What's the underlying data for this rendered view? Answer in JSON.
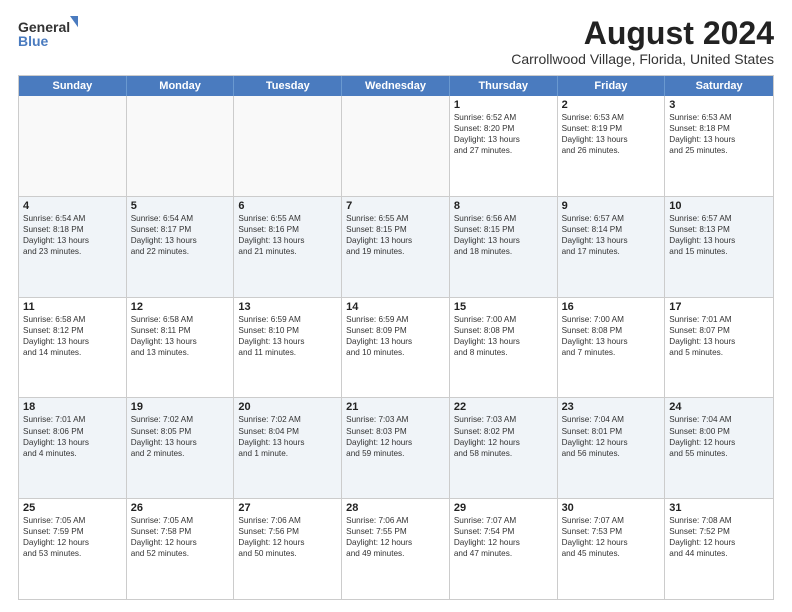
{
  "logo": {
    "line1": "General",
    "line2": "Blue"
  },
  "title": "August 2024",
  "subtitle": "Carrollwood Village, Florida, United States",
  "weekdays": [
    "Sunday",
    "Monday",
    "Tuesday",
    "Wednesday",
    "Thursday",
    "Friday",
    "Saturday"
  ],
  "weeks": [
    [
      {
        "day": "",
        "lines": [],
        "empty": true
      },
      {
        "day": "",
        "lines": [],
        "empty": true
      },
      {
        "day": "",
        "lines": [],
        "empty": true
      },
      {
        "day": "",
        "lines": [],
        "empty": true
      },
      {
        "day": "1",
        "lines": [
          "Sunrise: 6:52 AM",
          "Sunset: 8:20 PM",
          "Daylight: 13 hours",
          "and 27 minutes."
        ],
        "empty": false
      },
      {
        "day": "2",
        "lines": [
          "Sunrise: 6:53 AM",
          "Sunset: 8:19 PM",
          "Daylight: 13 hours",
          "and 26 minutes."
        ],
        "empty": false
      },
      {
        "day": "3",
        "lines": [
          "Sunrise: 6:53 AM",
          "Sunset: 8:18 PM",
          "Daylight: 13 hours",
          "and 25 minutes."
        ],
        "empty": false
      }
    ],
    [
      {
        "day": "4",
        "lines": [
          "Sunrise: 6:54 AM",
          "Sunset: 8:18 PM",
          "Daylight: 13 hours",
          "and 23 minutes."
        ],
        "empty": false
      },
      {
        "day": "5",
        "lines": [
          "Sunrise: 6:54 AM",
          "Sunset: 8:17 PM",
          "Daylight: 13 hours",
          "and 22 minutes."
        ],
        "empty": false
      },
      {
        "day": "6",
        "lines": [
          "Sunrise: 6:55 AM",
          "Sunset: 8:16 PM",
          "Daylight: 13 hours",
          "and 21 minutes."
        ],
        "empty": false
      },
      {
        "day": "7",
        "lines": [
          "Sunrise: 6:55 AM",
          "Sunset: 8:15 PM",
          "Daylight: 13 hours",
          "and 19 minutes."
        ],
        "empty": false
      },
      {
        "day": "8",
        "lines": [
          "Sunrise: 6:56 AM",
          "Sunset: 8:15 PM",
          "Daylight: 13 hours",
          "and 18 minutes."
        ],
        "empty": false
      },
      {
        "day": "9",
        "lines": [
          "Sunrise: 6:57 AM",
          "Sunset: 8:14 PM",
          "Daylight: 13 hours",
          "and 17 minutes."
        ],
        "empty": false
      },
      {
        "day": "10",
        "lines": [
          "Sunrise: 6:57 AM",
          "Sunset: 8:13 PM",
          "Daylight: 13 hours",
          "and 15 minutes."
        ],
        "empty": false
      }
    ],
    [
      {
        "day": "11",
        "lines": [
          "Sunrise: 6:58 AM",
          "Sunset: 8:12 PM",
          "Daylight: 13 hours",
          "and 14 minutes."
        ],
        "empty": false
      },
      {
        "day": "12",
        "lines": [
          "Sunrise: 6:58 AM",
          "Sunset: 8:11 PM",
          "Daylight: 13 hours",
          "and 13 minutes."
        ],
        "empty": false
      },
      {
        "day": "13",
        "lines": [
          "Sunrise: 6:59 AM",
          "Sunset: 8:10 PM",
          "Daylight: 13 hours",
          "and 11 minutes."
        ],
        "empty": false
      },
      {
        "day": "14",
        "lines": [
          "Sunrise: 6:59 AM",
          "Sunset: 8:09 PM",
          "Daylight: 13 hours",
          "and 10 minutes."
        ],
        "empty": false
      },
      {
        "day": "15",
        "lines": [
          "Sunrise: 7:00 AM",
          "Sunset: 8:08 PM",
          "Daylight: 13 hours",
          "and 8 minutes."
        ],
        "empty": false
      },
      {
        "day": "16",
        "lines": [
          "Sunrise: 7:00 AM",
          "Sunset: 8:08 PM",
          "Daylight: 13 hours",
          "and 7 minutes."
        ],
        "empty": false
      },
      {
        "day": "17",
        "lines": [
          "Sunrise: 7:01 AM",
          "Sunset: 8:07 PM",
          "Daylight: 13 hours",
          "and 5 minutes."
        ],
        "empty": false
      }
    ],
    [
      {
        "day": "18",
        "lines": [
          "Sunrise: 7:01 AM",
          "Sunset: 8:06 PM",
          "Daylight: 13 hours",
          "and 4 minutes."
        ],
        "empty": false
      },
      {
        "day": "19",
        "lines": [
          "Sunrise: 7:02 AM",
          "Sunset: 8:05 PM",
          "Daylight: 13 hours",
          "and 2 minutes."
        ],
        "empty": false
      },
      {
        "day": "20",
        "lines": [
          "Sunrise: 7:02 AM",
          "Sunset: 8:04 PM",
          "Daylight: 13 hours",
          "and 1 minute."
        ],
        "empty": false
      },
      {
        "day": "21",
        "lines": [
          "Sunrise: 7:03 AM",
          "Sunset: 8:03 PM",
          "Daylight: 12 hours",
          "and 59 minutes."
        ],
        "empty": false
      },
      {
        "day": "22",
        "lines": [
          "Sunrise: 7:03 AM",
          "Sunset: 8:02 PM",
          "Daylight: 12 hours",
          "and 58 minutes."
        ],
        "empty": false
      },
      {
        "day": "23",
        "lines": [
          "Sunrise: 7:04 AM",
          "Sunset: 8:01 PM",
          "Daylight: 12 hours",
          "and 56 minutes."
        ],
        "empty": false
      },
      {
        "day": "24",
        "lines": [
          "Sunrise: 7:04 AM",
          "Sunset: 8:00 PM",
          "Daylight: 12 hours",
          "and 55 minutes."
        ],
        "empty": false
      }
    ],
    [
      {
        "day": "25",
        "lines": [
          "Sunrise: 7:05 AM",
          "Sunset: 7:59 PM",
          "Daylight: 12 hours",
          "and 53 minutes."
        ],
        "empty": false
      },
      {
        "day": "26",
        "lines": [
          "Sunrise: 7:05 AM",
          "Sunset: 7:58 PM",
          "Daylight: 12 hours",
          "and 52 minutes."
        ],
        "empty": false
      },
      {
        "day": "27",
        "lines": [
          "Sunrise: 7:06 AM",
          "Sunset: 7:56 PM",
          "Daylight: 12 hours",
          "and 50 minutes."
        ],
        "empty": false
      },
      {
        "day": "28",
        "lines": [
          "Sunrise: 7:06 AM",
          "Sunset: 7:55 PM",
          "Daylight: 12 hours",
          "and 49 minutes."
        ],
        "empty": false
      },
      {
        "day": "29",
        "lines": [
          "Sunrise: 7:07 AM",
          "Sunset: 7:54 PM",
          "Daylight: 12 hours",
          "and 47 minutes."
        ],
        "empty": false
      },
      {
        "day": "30",
        "lines": [
          "Sunrise: 7:07 AM",
          "Sunset: 7:53 PM",
          "Daylight: 12 hours",
          "and 45 minutes."
        ],
        "empty": false
      },
      {
        "day": "31",
        "lines": [
          "Sunrise: 7:08 AM",
          "Sunset: 7:52 PM",
          "Daylight: 12 hours",
          "and 44 minutes."
        ],
        "empty": false
      }
    ]
  ]
}
